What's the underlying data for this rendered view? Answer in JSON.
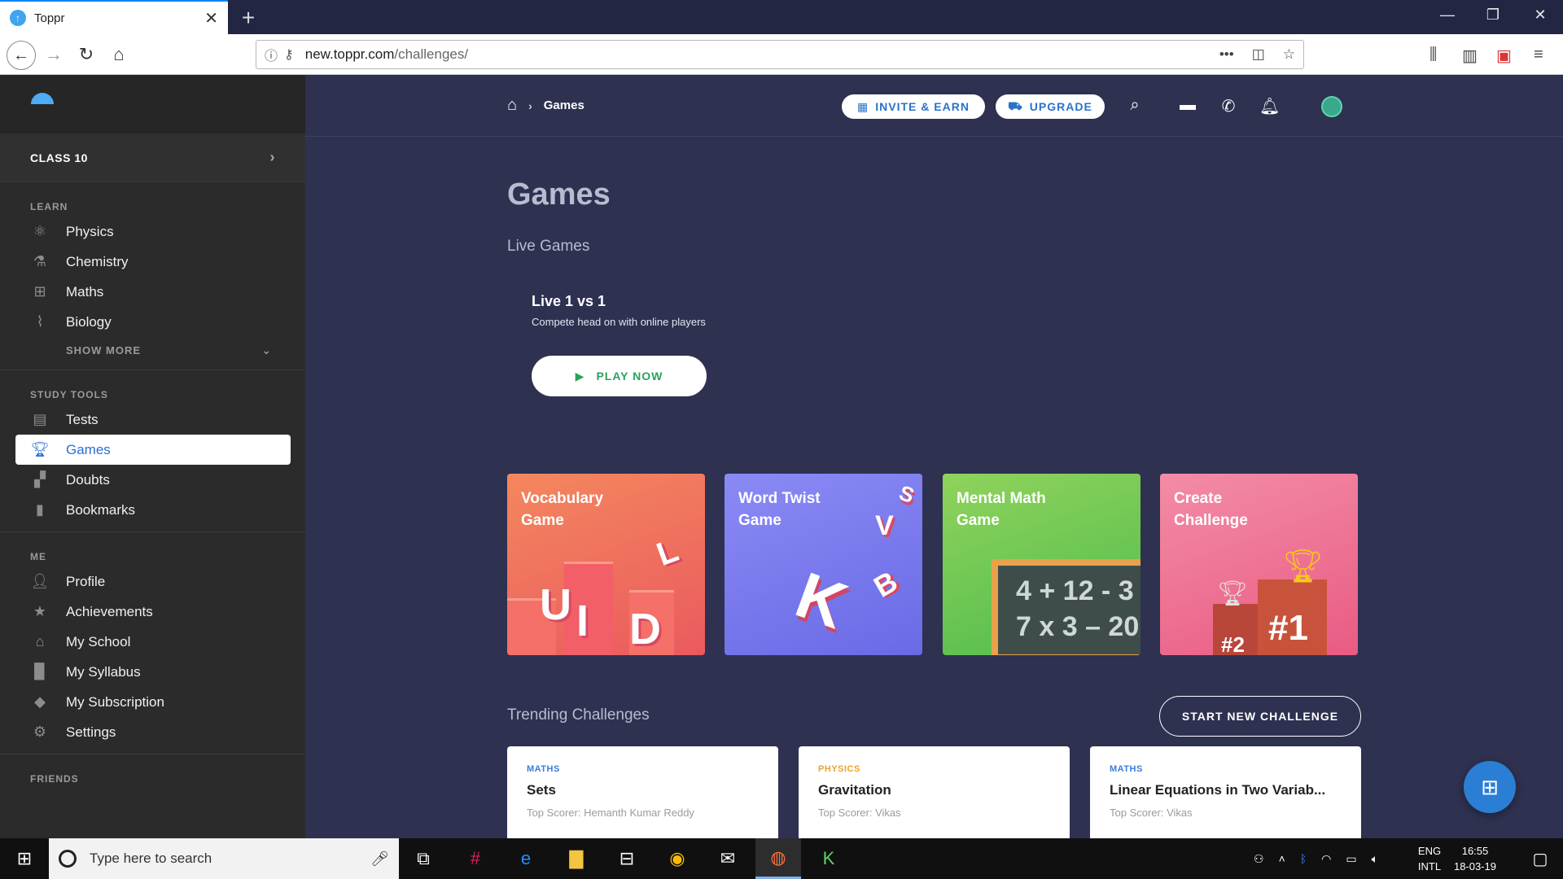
{
  "browser": {
    "tab_title": "Toppr",
    "url_host": "new.toppr.com",
    "url_path": "/challenges/",
    "window_controls": [
      "—",
      "❐",
      "✕"
    ]
  },
  "sidebar": {
    "class_label": "CLASS 10",
    "learn_heading": "LEARN",
    "learn_items": [
      {
        "label": "Physics",
        "icon": "atom-icon"
      },
      {
        "label": "Chemistry",
        "icon": "flask-icon"
      },
      {
        "label": "Maths",
        "icon": "grid-icon"
      },
      {
        "label": "Biology",
        "icon": "dna-icon"
      }
    ],
    "show_more": "SHOW MORE",
    "study_heading": "STUDY TOOLS",
    "study_items": [
      {
        "label": "Tests",
        "icon": "clipboard-icon"
      },
      {
        "label": "Games",
        "icon": "trophy-icon",
        "active": true
      },
      {
        "label": "Doubts",
        "icon": "chat-icon"
      },
      {
        "label": "Bookmarks",
        "icon": "bookmark-icon"
      }
    ],
    "me_heading": "ME",
    "me_items": [
      {
        "label": "Profile",
        "icon": "person-icon"
      },
      {
        "label": "Achievements",
        "icon": "star-icon"
      },
      {
        "label": "My School",
        "icon": "school-icon"
      },
      {
        "label": "My Syllabus",
        "icon": "book-icon"
      },
      {
        "label": "My Subscription",
        "icon": "tag-icon"
      },
      {
        "label": "Settings",
        "icon": "gear-icon"
      }
    ],
    "friends_heading": "FRIENDS"
  },
  "header": {
    "breadcrumb_current": "Games",
    "invite_label": "INVITE & EARN",
    "upgrade_label": "UPGRADE"
  },
  "main": {
    "title": "Games",
    "live_heading": "Live Games",
    "live_title": "Live 1 vs 1",
    "live_desc": "Compete head on with online players",
    "play_label": "PLAY NOW",
    "games": [
      {
        "title": "Vocabulary Game"
      },
      {
        "title": "Word Twist Game"
      },
      {
        "title": "Mental Math Game"
      },
      {
        "title": "Create Challenge"
      }
    ],
    "math_board_line1": "4 + 12 - 3",
    "math_board_line2": "7 x 3 – 20",
    "trending_heading": "Trending Challenges",
    "start_label": "START NEW CHALLENGE",
    "challenges": [
      {
        "subject": "MATHS",
        "subject_color": "#3b7bd8",
        "name": "Sets",
        "scorer": "Top Scorer: Hemanth Kumar Reddy"
      },
      {
        "subject": "PHYSICS",
        "subject_color": "#e8a42c",
        "name": "Gravitation",
        "scorer": "Top Scorer: Vikas"
      },
      {
        "subject": "MATHS",
        "subject_color": "#3b7bd8",
        "name": "Linear Equations in Two Variab...",
        "scorer": "Top Scorer: Vikas"
      }
    ]
  },
  "taskbar": {
    "search_placeholder": "Type here to search",
    "lang_line1": "ENG",
    "lang_line2": "INTL",
    "time": "16:55",
    "date": "18-03-19"
  }
}
